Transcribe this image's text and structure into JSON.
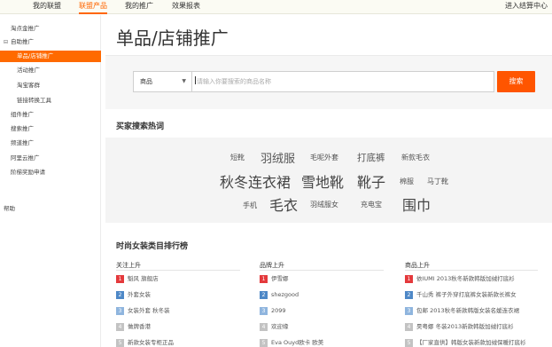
{
  "topnav": {
    "items": [
      "我的联盟",
      "联盟产品",
      "我的推广",
      "效果报表"
    ],
    "right_link": "进入结算中心"
  },
  "sidebar": {
    "items": [
      {
        "label": "淘点金推广"
      },
      {
        "label": "自助推广",
        "expandable": true
      },
      {
        "label": "单品/店铺推广",
        "selected": true
      },
      {
        "label": "活动推广"
      },
      {
        "label": "淘宝客群"
      },
      {
        "label": "链接转换工具"
      },
      {
        "label": "组件推广"
      },
      {
        "label": "搜索推广"
      },
      {
        "label": "频道推广"
      },
      {
        "label": "阿里云推广"
      },
      {
        "label": "阶梯奖励申请"
      }
    ],
    "help": "帮助"
  },
  "page": {
    "title": "单品/店铺推广"
  },
  "search": {
    "type_label": "商品",
    "placeholder": "请输入你要搜索的商品名称",
    "button": "搜索"
  },
  "hot": {
    "title": "买家搜索热词",
    "row1": [
      "短靴",
      "羽绒服",
      "毛呢外套",
      "打底裤",
      "新款毛衣"
    ],
    "row2": [
      "秋冬连衣裙",
      "雪地靴",
      "靴子",
      "棉服",
      "马丁靴"
    ],
    "row3": [
      "手机",
      "毛衣",
      "羽绒服女",
      "充电宝",
      "围巾"
    ]
  },
  "ranking": {
    "title": "时尚女装类目排行榜",
    "columns": [
      {
        "head": "关注上升",
        "rows": [
          "魁风 旗舰店",
          "外套女装",
          "女装外套 秋冬装",
          "做牌香港",
          "新款女装专柜正品"
        ]
      },
      {
        "head": "品牌上升",
        "rows": [
          "伊雪娜",
          "shezgood",
          "2099",
          "欢迎缘",
          "Eva Ouyd欧卡 欧美"
        ]
      },
      {
        "head": "商品上升",
        "rows": [
          "依IUMI 2013秋冬新款韩版加绒打底衫",
          "千山秀 裤子外穿打底裤女装新款长裤女",
          "包邮 2013秋冬新款韩版女装名媛连衣裙",
          "昊粤娜 冬装2013新款韩版加绒打底衫",
          "【厂家直供】韩版女装新款加绒保暖打底衫"
        ]
      }
    ]
  }
}
